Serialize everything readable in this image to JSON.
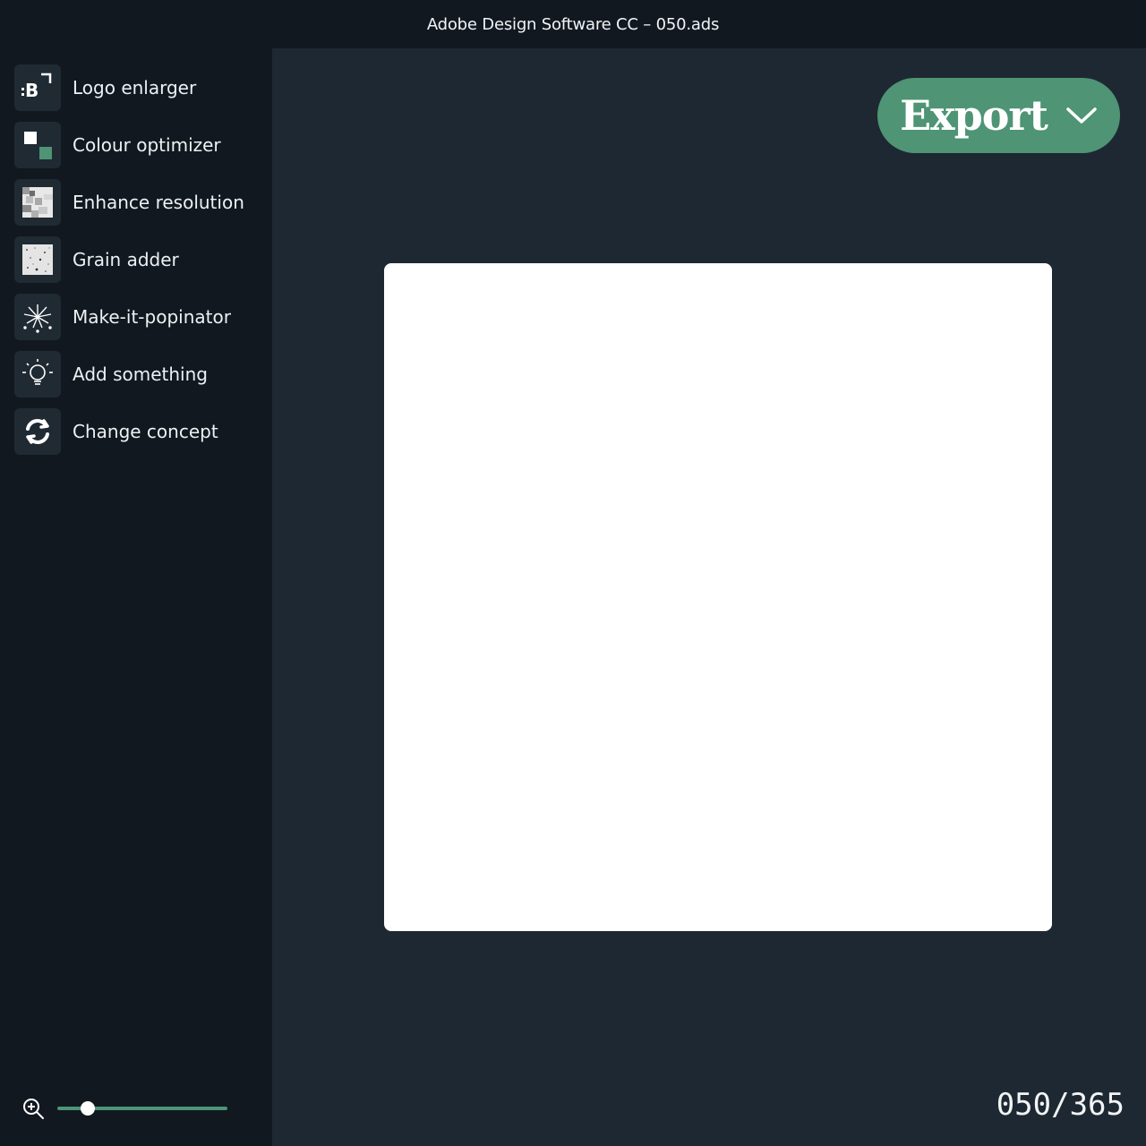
{
  "window": {
    "title": "Adobe Design Software CC – 050.ads"
  },
  "tools": [
    {
      "label": "Logo enlarger",
      "icon": "logo-enlarge-icon"
    },
    {
      "label": "Colour optimizer",
      "icon": "colour-squares-icon"
    },
    {
      "label": "Enhance resolution",
      "icon": "pixelated-image-icon"
    },
    {
      "label": "Grain adder",
      "icon": "grain-texture-icon"
    },
    {
      "label": "Make-it-popinator",
      "icon": "fireworks-icon"
    },
    {
      "label": "Add something",
      "icon": "lightbulb-icon"
    },
    {
      "label": "Change concept",
      "icon": "refresh-icon"
    }
  ],
  "zoom": {
    "icon": "zoom-in-icon",
    "level": 0.18
  },
  "export": {
    "label": "Export",
    "icon": "chevron-down-icon"
  },
  "counter": {
    "text": "050/365"
  },
  "colors": {
    "accent": "#4e9475",
    "sidebar": "#111820",
    "workspace": "#1e2832",
    "canvas": "#ffffff"
  }
}
